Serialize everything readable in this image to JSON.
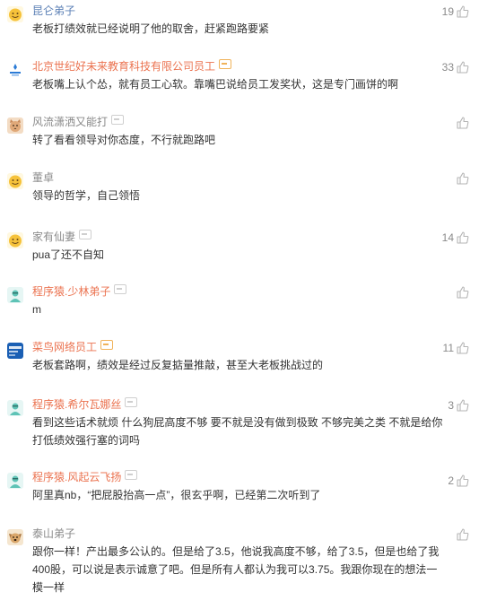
{
  "comments": [
    {
      "username": "昆仑弟子",
      "text": "老板打绩效就已经说明了他的取舍，赶紧跑路要紧",
      "likes": "19",
      "avatar": "smiley-avatar-icon",
      "badge": "",
      "name_style": "blue"
    },
    {
      "username": "北京世纪好未来教育科技有限公司员工",
      "text": "老板嘴上认个怂，就有员工心软。靠嘴巴说给员工发奖状，这是专门画饼的啊",
      "likes": "33",
      "avatar": "company-logo-avatar-icon",
      "badge": "gold",
      "name_style": "vip"
    },
    {
      "username": "风流潇洒又能打",
      "text": "转了看看领导对你态度，不行就跑路吧",
      "likes": "",
      "avatar": "cat-avatar-icon",
      "badge": "grey",
      "name_style": ""
    },
    {
      "username": "董卓",
      "text": "领导的哲学，自己领悟",
      "likes": "",
      "avatar": "smiley-avatar-icon",
      "badge": "",
      "name_style": ""
    },
    {
      "username": "家有仙妻",
      "text": "pua了还不自知",
      "likes": "14",
      "avatar": "smiley-avatar-icon",
      "badge": "grey",
      "name_style": ""
    },
    {
      "username": "程序猿.少林弟子",
      "text": "m",
      "likes": "",
      "avatar": "coder-avatar-icon",
      "badge": "grey",
      "name_style": "vip"
    },
    {
      "username": "菜鸟网络员工",
      "text": "老板套路啊，绩效是经过反复掂量推敲，甚至大老板挑战过的",
      "likes": "11",
      "avatar": "cainiao-logo-avatar-icon",
      "badge": "gold",
      "name_style": "vip"
    },
    {
      "username": "程序猿.希尔瓦娜丝",
      "text": "看到这些话术就烦 什么狗屁高度不够 要不就是没有做到极致 不够完美之类 不就是给你打低绩效强行塞的词吗",
      "likes": "3",
      "avatar": "coder-avatar-icon",
      "badge": "grey",
      "name_style": "vip"
    },
    {
      "username": "程序猿.风起云飞扬",
      "text": "阿里真nb，“把屁股抬高一点”，很玄乎啊，已经第二次听到了",
      "likes": "2",
      "avatar": "coder-avatar-icon",
      "badge": "grey",
      "name_style": "vip"
    },
    {
      "username": "泰山弟子",
      "text": "跟你一样！产出最多公认的。但是给了3.5，他说我高度不够，给了3.5，但是也给了我400股，可以说是表示诚意了吧。但是所有人都认为我可以3.75。我跟你现在的想法一模一样",
      "likes": "",
      "avatar": "dog-avatar-icon",
      "badge": "",
      "name_style": ""
    }
  ]
}
